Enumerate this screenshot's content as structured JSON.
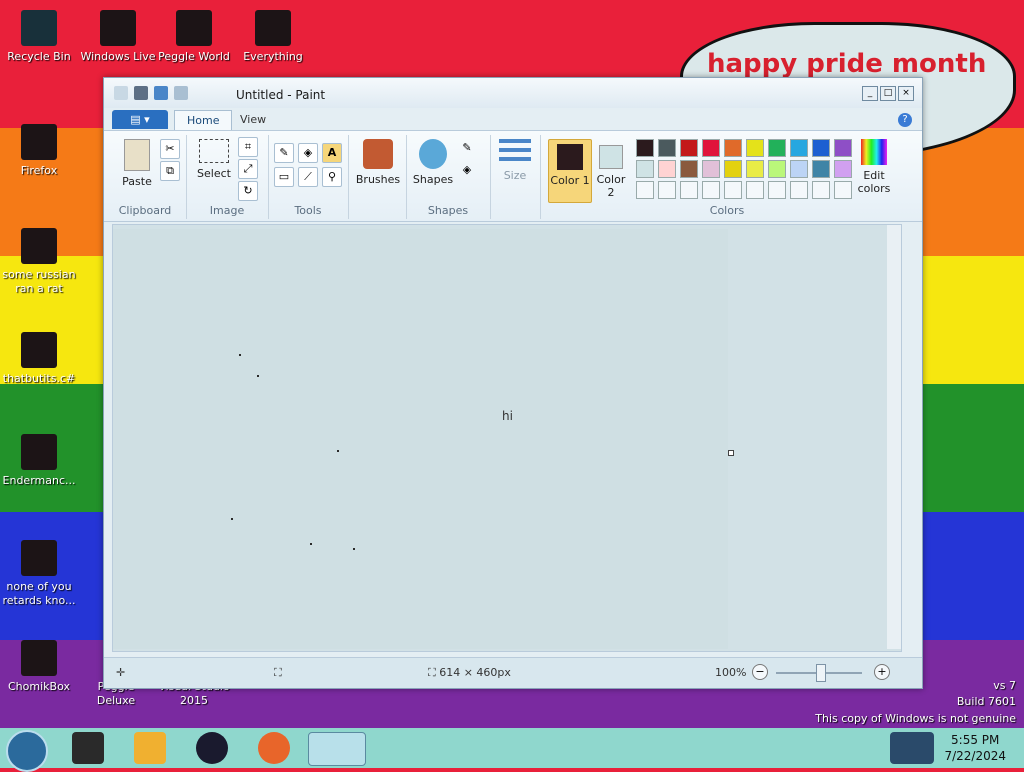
{
  "desktop": {
    "bubble_text": "happy pride month",
    "icons": [
      {
        "label": "Recycle Bin",
        "icon": "recycle-bin-icon"
      },
      {
        "label": "Windows Live",
        "icon": "windows-live-icon"
      },
      {
        "label": "Peggle World",
        "icon": "peggle-icon"
      },
      {
        "label": "Everything",
        "icon": "everything-icon"
      },
      {
        "label": "Firefox",
        "icon": "firefox-icon"
      },
      {
        "label": "some russian ran a rat",
        "icon": "rat-icon"
      },
      {
        "label": "thatbutits.c#",
        "icon": "file-icon"
      },
      {
        "label": "Endermanc...",
        "icon": "folder-icon"
      },
      {
        "label": "none of you retards kno...",
        "icon": "firefox-icon"
      },
      {
        "label": "ChomikBox",
        "icon": "chomikbox-icon"
      },
      {
        "label": "Peggle Deluxe",
        "icon": "peggle-icon"
      },
      {
        "label": "Visual Studio 2015",
        "icon": "visual-studio-icon"
      }
    ],
    "version_lines": [
      "vs 7",
      "Build 7601"
    ],
    "genuine_text": "This copy of Windows is not genuine"
  },
  "window": {
    "title": "Untitled - Paint",
    "tabs": {
      "home": "Home",
      "view": "View"
    },
    "ribbon": {
      "paste": "Paste",
      "select": "Select",
      "brushes": "Brushes",
      "shapes": "Shapes",
      "size": "Size",
      "color1": "Color 1",
      "color2": "Color 2",
      "edit_colors": "Edit colors",
      "groups": {
        "clipboard": "Clipboard",
        "image": "Image",
        "tools": "Tools",
        "shapes": "Shapes",
        "colors": "Colors"
      }
    },
    "palette": {
      "row1": [
        "#2b1a1d",
        "#4b5a5e",
        "#c3191a",
        "#e0143b",
        "#e06a2a",
        "#e4e21a",
        "#22b15a",
        "#26a7e0",
        "#1c5fd1",
        "#8e4fc6"
      ],
      "row2": [
        "#cfe3e5",
        "#ffd3d3",
        "#8a5a3e",
        "#e1c0d8",
        "#e3d10f",
        "#e9ec46",
        "#baf77a",
        "#bcd4f5",
        "#3f84a6",
        "#d1a0f0"
      ]
    },
    "canvas_text": "hi",
    "status": {
      "size": "614 × 460px",
      "zoom": "100%"
    }
  },
  "taskbar": {
    "time": "5:55 PM",
    "date": "7/22/2024"
  }
}
